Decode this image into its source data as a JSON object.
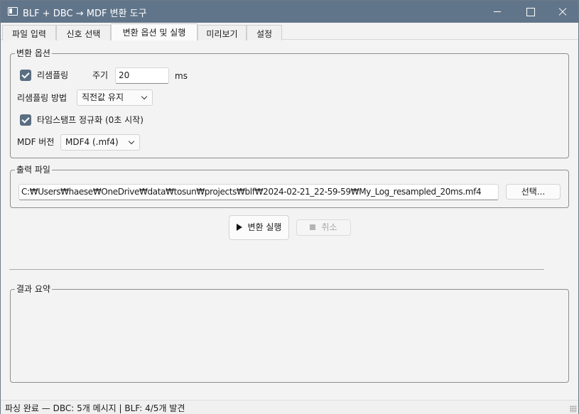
{
  "window": {
    "title": "BLF + DBC → MDF 변환 도구"
  },
  "tabs": [
    {
      "label": "파일 입력",
      "active": false
    },
    {
      "label": "신호 선택",
      "active": false
    },
    {
      "label": "변환 옵션 및 실행",
      "active": true
    },
    {
      "label": "미리보기",
      "active": false
    },
    {
      "label": "설정",
      "active": false
    }
  ],
  "conversion_options": {
    "title": "변환 옵션",
    "resampling": {
      "label": "리샘플링",
      "checked": true
    },
    "period": {
      "label": "주기",
      "value": "20",
      "unit": "ms"
    },
    "resampling_method": {
      "label": "리샘플링 방법",
      "selected": "직전값 유지"
    },
    "timestamp_normalize": {
      "label": "타임스탬프 정규화 (0초 시작)",
      "checked": true
    },
    "mdf_version": {
      "label": "MDF 버전",
      "selected": "MDF4 (.mf4)"
    }
  },
  "output_file": {
    "title": "출력 파일",
    "path": "C:₩Users₩haese₩OneDrive₩data₩tosun₩projects₩blf₩2024-02-21_22-59-59₩My_Log_resampled_20ms.mf4",
    "browse_label": "선택..."
  },
  "actions": {
    "run_label": "변환 실행",
    "cancel_label": "취소",
    "cancel_enabled": false
  },
  "result_summary": {
    "title": "결과 요약",
    "text": ""
  },
  "status": {
    "text": "파싱 완료 — DBC: 5개 메시지  |  BLF: 4/5개 발견"
  },
  "colors": {
    "titlebar": "#61758a",
    "checkbox": "#5a6e82"
  }
}
